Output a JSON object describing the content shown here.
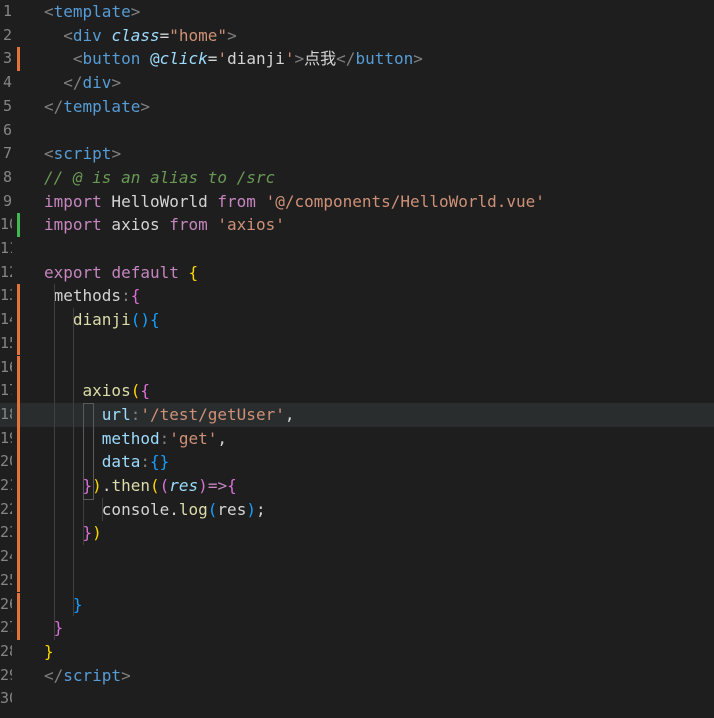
{
  "editor": {
    "colors": {
      "modified": "#e2733a",
      "added": "#3fb950"
    },
    "lines": [
      {
        "n": "1",
        "gutter": "",
        "tokens": [
          [
            "c-punc",
            "<"
          ],
          [
            "c-tag",
            "template"
          ],
          [
            "c-punc",
            ">"
          ]
        ]
      },
      {
        "n": "2",
        "gutter": "",
        "tokens": [
          [
            "c-white",
            "  "
          ],
          [
            "c-punc",
            "<"
          ],
          [
            "c-tag",
            "div"
          ],
          [
            "c-white",
            " "
          ],
          [
            "c-attr-i",
            "class"
          ],
          [
            "c-white",
            "="
          ],
          [
            "c-str",
            "\"home\""
          ],
          [
            "c-punc",
            ">"
          ]
        ]
      },
      {
        "n": "3",
        "gutter": "modified",
        "tokens": [
          [
            "c-white",
            "   "
          ],
          [
            "c-punc",
            "<"
          ],
          [
            "c-tag",
            "button"
          ],
          [
            "c-white",
            " "
          ],
          [
            "c-attr",
            "@"
          ],
          [
            "c-attr-i",
            "click"
          ],
          [
            "c-white",
            "="
          ],
          [
            "c-str",
            "'"
          ],
          [
            "c-white",
            "dianji"
          ],
          [
            "c-str",
            "'"
          ],
          [
            "c-punc",
            ">"
          ],
          [
            "c-white",
            "点我"
          ],
          [
            "c-punc",
            "</"
          ],
          [
            "c-tag",
            "button"
          ],
          [
            "c-punc",
            ">"
          ]
        ]
      },
      {
        "n": "4",
        "gutter": "",
        "tokens": [
          [
            "c-white",
            "  "
          ],
          [
            "c-punc",
            "</"
          ],
          [
            "c-tag",
            "div"
          ],
          [
            "c-punc",
            ">"
          ]
        ]
      },
      {
        "n": "5",
        "gutter": "",
        "tokens": [
          [
            "c-punc",
            "</"
          ],
          [
            "c-tag",
            "template"
          ],
          [
            "c-punc",
            ">"
          ]
        ]
      },
      {
        "n": "6",
        "gutter": "",
        "tokens": []
      },
      {
        "n": "7",
        "gutter": "",
        "tokens": [
          [
            "c-punc",
            "<"
          ],
          [
            "c-tag",
            "script"
          ],
          [
            "c-punc",
            ">"
          ]
        ]
      },
      {
        "n": "8",
        "gutter": "",
        "tokens": [
          [
            "c-cm",
            "// @ is an alias to /src"
          ]
        ]
      },
      {
        "n": "9",
        "gutter": "",
        "tokens": [
          [
            "c-kw",
            "import"
          ],
          [
            "c-white",
            " HelloWorld "
          ],
          [
            "c-kw",
            "from"
          ],
          [
            "c-white",
            " "
          ],
          [
            "c-str",
            "'@/components/HelloWorld.vue'"
          ]
        ]
      },
      {
        "n": "10",
        "gutter": "added",
        "tokens": [
          [
            "c-kw",
            "import"
          ],
          [
            "c-white",
            " axios "
          ],
          [
            "c-kw",
            "from"
          ],
          [
            "c-white",
            " "
          ],
          [
            "c-str",
            "'axios'"
          ]
        ]
      },
      {
        "n": "11",
        "gutter": "",
        "tokens": []
      },
      {
        "n": "12",
        "gutter": "",
        "tokens": [
          [
            "c-kw",
            "export"
          ],
          [
            "c-white",
            " "
          ],
          [
            "c-kw",
            "default"
          ],
          [
            "c-white",
            " "
          ],
          [
            "c-br1",
            "{"
          ]
        ]
      },
      {
        "n": "13",
        "gutter": "modified",
        "tokens": [
          [
            "c-white",
            " methods"
          ],
          [
            "c-punc",
            ":"
          ],
          [
            "c-br2",
            "{"
          ]
        ]
      },
      {
        "n": "14",
        "gutter": "modified",
        "tokens": [
          [
            "c-white",
            "   "
          ],
          [
            "c-fn",
            "dianji"
          ],
          [
            "c-br3",
            "()"
          ],
          [
            "c-br3",
            "{"
          ]
        ]
      },
      {
        "n": "15",
        "gutter": "modified",
        "tokens": []
      },
      {
        "n": "16",
        "gutter": "modified",
        "tokens": []
      },
      {
        "n": "17",
        "gutter": "modified",
        "tokens": [
          [
            "c-white",
            "    "
          ],
          [
            "c-fn",
            "axios"
          ],
          [
            "c-br1",
            "("
          ],
          [
            "c-br2",
            "{"
          ]
        ]
      },
      {
        "n": "18",
        "gutter": "modified",
        "current": true,
        "tokens": [
          [
            "c-white",
            "      "
          ],
          [
            "c-prop",
            "url"
          ],
          [
            "c-punc",
            ":"
          ],
          [
            "c-str",
            "'/test/getUser'"
          ],
          [
            "c-white",
            ","
          ]
        ]
      },
      {
        "n": "19",
        "gutter": "modified",
        "tokens": [
          [
            "c-white",
            "      "
          ],
          [
            "c-prop",
            "method"
          ],
          [
            "c-punc",
            ":"
          ],
          [
            "c-str",
            "'get'"
          ],
          [
            "c-white",
            ","
          ]
        ]
      },
      {
        "n": "20",
        "gutter": "modified",
        "tokens": [
          [
            "c-white",
            "      "
          ],
          [
            "c-prop",
            "data"
          ],
          [
            "c-punc",
            ":"
          ],
          [
            "c-br3",
            "{}"
          ]
        ]
      },
      {
        "n": "21",
        "gutter": "modified",
        "tokens": [
          [
            "c-white",
            "    "
          ],
          [
            "c-br2",
            "}"
          ],
          [
            "c-br1",
            ")"
          ],
          [
            "c-white",
            "."
          ],
          [
            "c-fn",
            "then"
          ],
          [
            "c-br1",
            "("
          ],
          [
            "c-br2",
            "("
          ],
          [
            "c-var",
            "res"
          ],
          [
            "c-br2",
            ")"
          ],
          [
            "c-kw",
            "=>"
          ],
          [
            "c-br2",
            "{"
          ]
        ]
      },
      {
        "n": "22",
        "gutter": "modified",
        "tokens": [
          [
            "c-white",
            "      console"
          ],
          [
            "c-white",
            "."
          ],
          [
            "c-fn",
            "log"
          ],
          [
            "c-br3",
            "("
          ],
          [
            "c-white",
            "res"
          ],
          [
            "c-br3",
            ")"
          ],
          [
            "c-white",
            ";"
          ]
        ]
      },
      {
        "n": "23",
        "gutter": "modified",
        "tokens": [
          [
            "c-white",
            "    "
          ],
          [
            "c-br2",
            "}"
          ],
          [
            "c-br1",
            ")"
          ]
        ]
      },
      {
        "n": "24",
        "gutter": "modified",
        "tokens": []
      },
      {
        "n": "25",
        "gutter": "modified",
        "tokens": []
      },
      {
        "n": "26",
        "gutter": "modified",
        "tokens": [
          [
            "c-white",
            "   "
          ],
          [
            "c-br3",
            "}"
          ]
        ]
      },
      {
        "n": "27",
        "gutter": "modified",
        "tokens": [
          [
            "c-white",
            " "
          ],
          [
            "c-br2",
            "}"
          ]
        ]
      },
      {
        "n": "28",
        "gutter": "",
        "tokens": [
          [
            "c-br1",
            "}"
          ]
        ]
      },
      {
        "n": "29",
        "gutter": "",
        "tokens": [
          [
            "c-punc",
            "</"
          ],
          [
            "c-tag",
            "script"
          ],
          [
            "c-punc",
            ">"
          ]
        ]
      },
      {
        "n": "30",
        "gutter": "",
        "tokens": []
      }
    ]
  }
}
